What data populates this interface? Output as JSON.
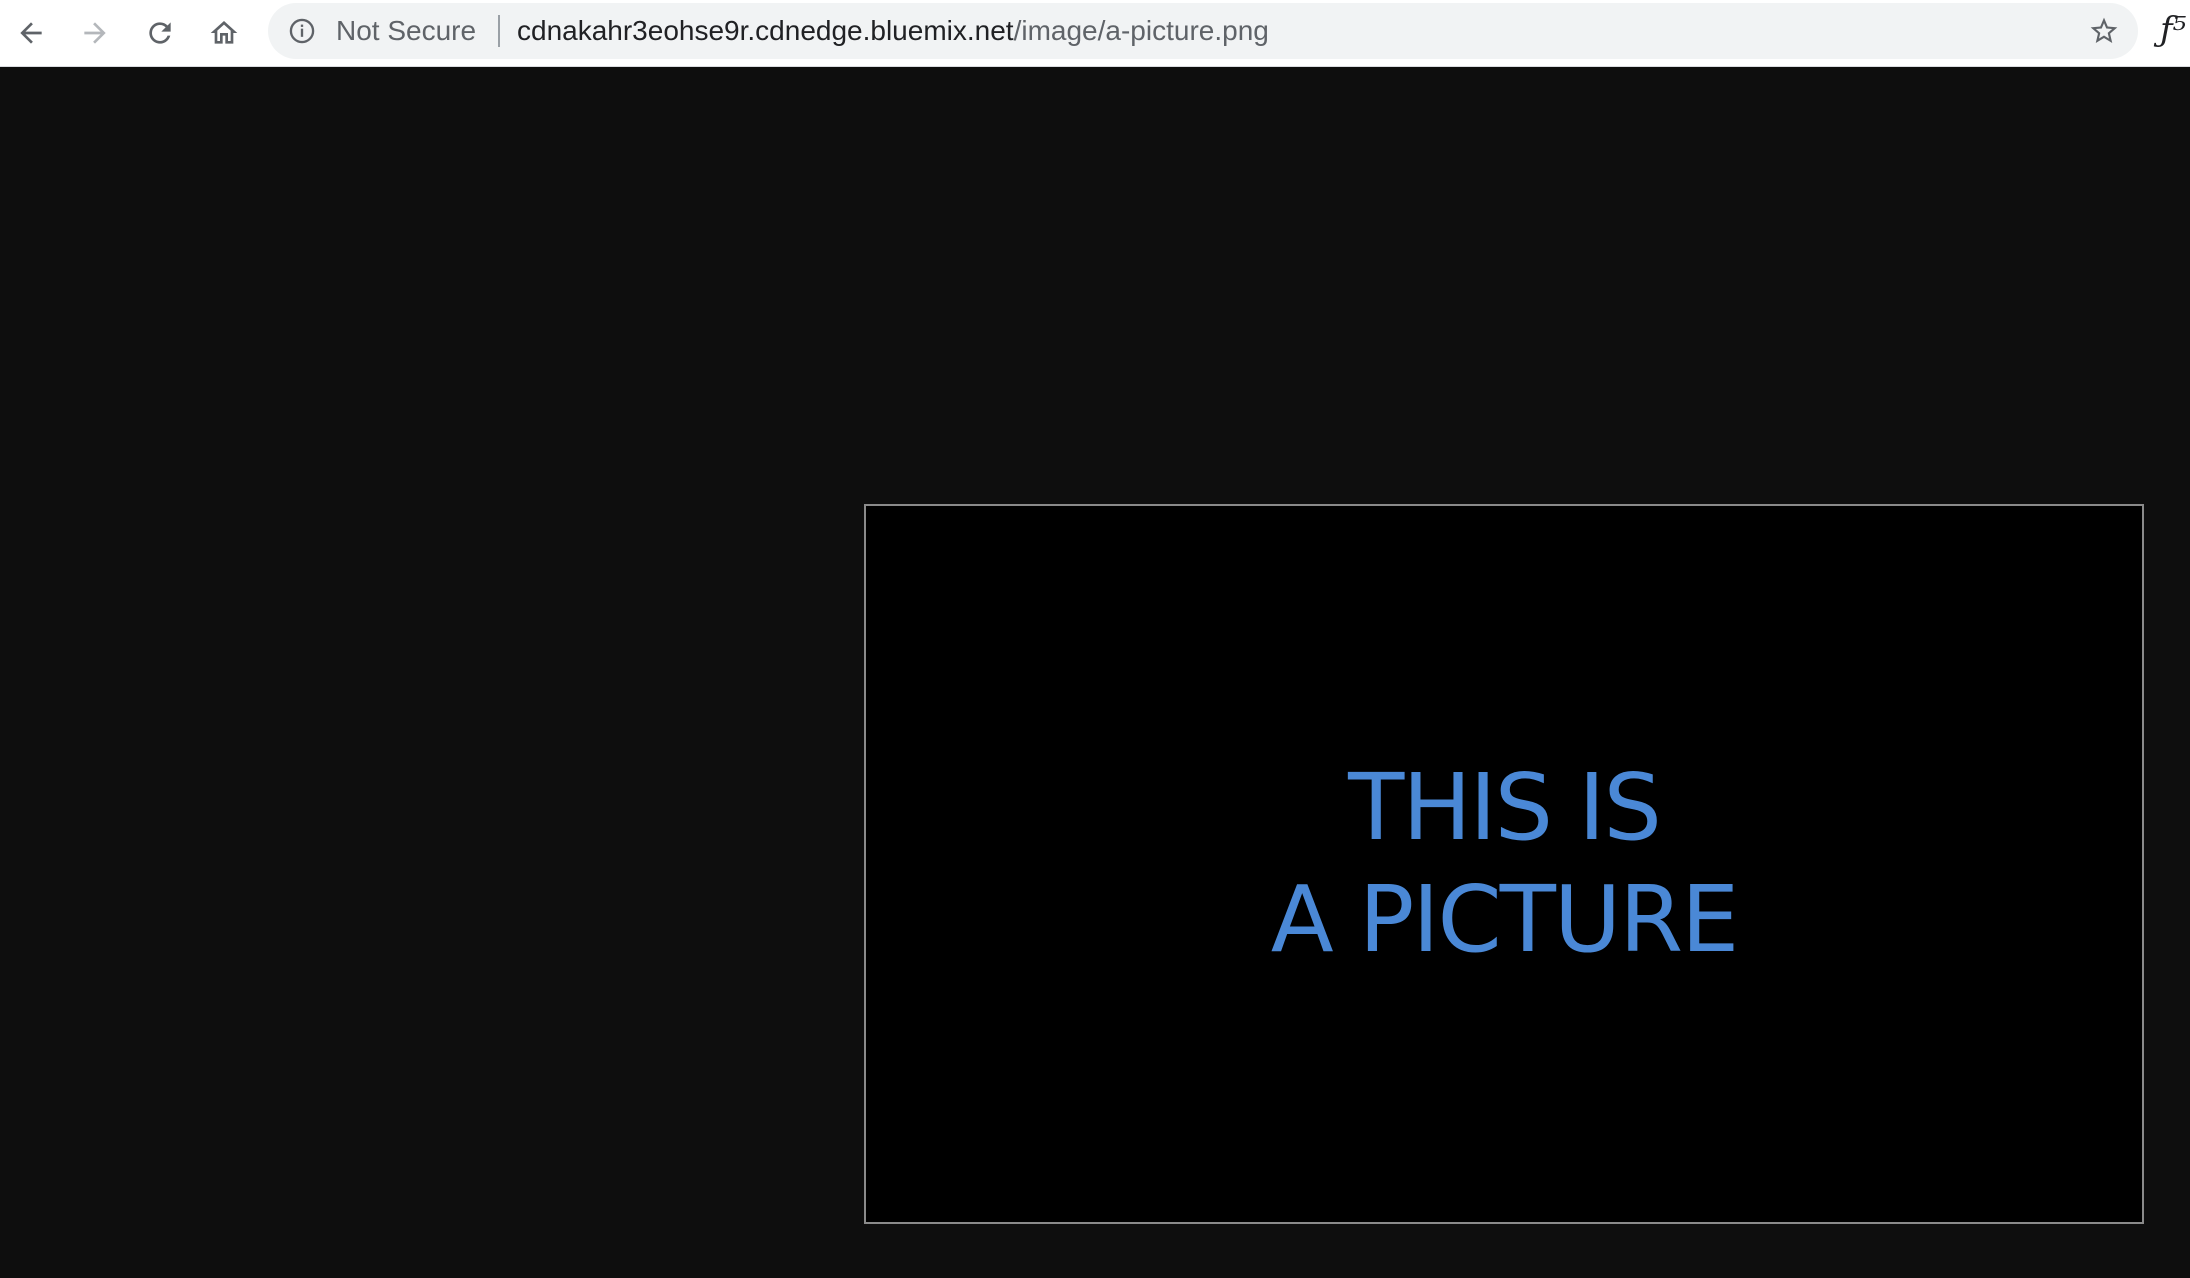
{
  "browser": {
    "nav": {
      "back_icon": "arrow-left-icon",
      "forward_icon": "arrow-right-icon",
      "reload_icon": "reload-icon",
      "home_icon": "home-icon"
    },
    "omnibox": {
      "security_icon": "info-icon",
      "security_label": "Not Secure",
      "url_host": "cdnakahr3eohse9r.cdnedge.bluemix.net",
      "url_path": "/image/a-picture.png",
      "bookmark_icon": "star-icon"
    },
    "extension_glyph": "ƒ⁵"
  },
  "content": {
    "image_text": {
      "line1": "THIS IS",
      "line2": "A PICTURE"
    },
    "colors": {
      "page_background": "#0e0e0e",
      "image_background": "#000000",
      "image_text": "#4a88d6",
      "image_border": "#8a8a8a"
    }
  }
}
